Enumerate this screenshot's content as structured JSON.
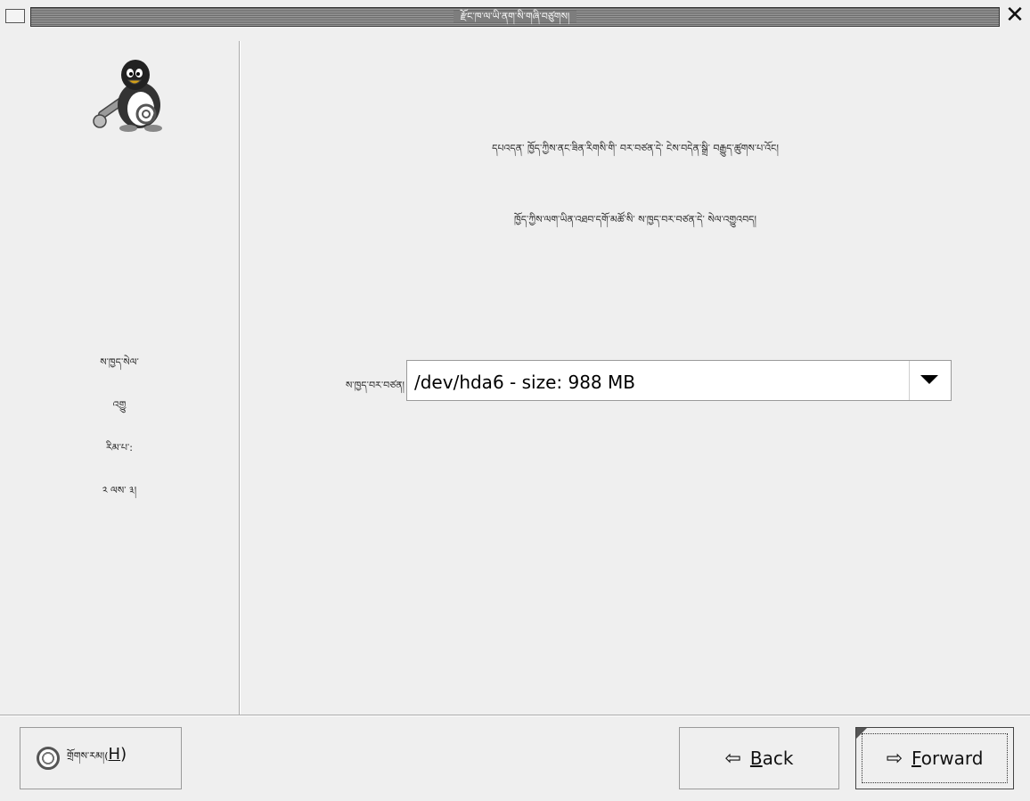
{
  "window": {
    "title": "རྫོང་ཁ་ལ་ཡི་ནག་སི་གཞི་བཙུགས།",
    "close_glyph": "✕"
  },
  "sidebar": {
    "steps": [
      "ས་ཁྱད་སེལ་",
      "འགྱུ",
      "རིམ་པ་:",
      "༢ ལས་ ༣།"
    ]
  },
  "main": {
    "line1": "དཔའདན་ ཁྱོད་ཀྱིས་ནང་ཟིན་རིགསི་གི་ བར་བཙན་དེ་ ངེས་བདེན་སྒྲི་ བརྒྱུད་ཚུགས་པ་འོང།",
    "line2": "ཁྱོད་ཀྱིས་ལག་ཡིན་འཐབ་དགོ་མཚོ་སི་ ས་ཁྱད་བར་བཙན་དེ་ སེལ་འགྱུའབད།",
    "partition_label": "ས་ཁྱད་བར་བཙན།",
    "partition_value": "/dev/hda6 - size: 988 MB"
  },
  "buttons": {
    "help_label": "གྲོགས་རམ།(",
    "help_accel": "H",
    "help_close": ")",
    "back_accel": "B",
    "back_rest": "ack",
    "forward_accel": "F",
    "forward_rest": "orward"
  },
  "icons": {
    "back": "back-arrow-icon",
    "forward": "forward-arrow-icon",
    "help": "lifebuoy-icon",
    "logo": "tux-tools-icon"
  }
}
